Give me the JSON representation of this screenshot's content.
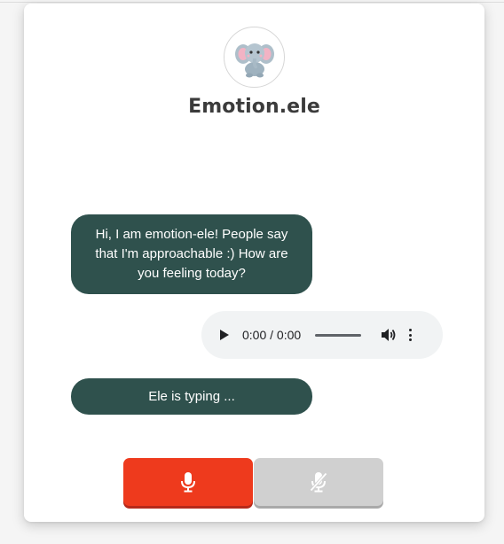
{
  "app": {
    "title": "Emotion.ele"
  },
  "colors": {
    "bubble_bg": "#2f514d",
    "record_button": "#ee3a1d",
    "stop_button": "#d0d0d0",
    "audio_bg": "#f1f3f4"
  },
  "messages": [
    {
      "sender": "ele",
      "text": "Hi, I am emotion-ele! People say that I'm approachable :) How are you feeling today?"
    },
    {
      "sender": "user",
      "type": "audio",
      "time": "0:00 / 0:00"
    },
    {
      "sender": "ele",
      "text": "Ele is typing ..."
    }
  ],
  "controls": {
    "record_icon": "microphone-icon",
    "stop_icon": "microphone-off-icon"
  }
}
